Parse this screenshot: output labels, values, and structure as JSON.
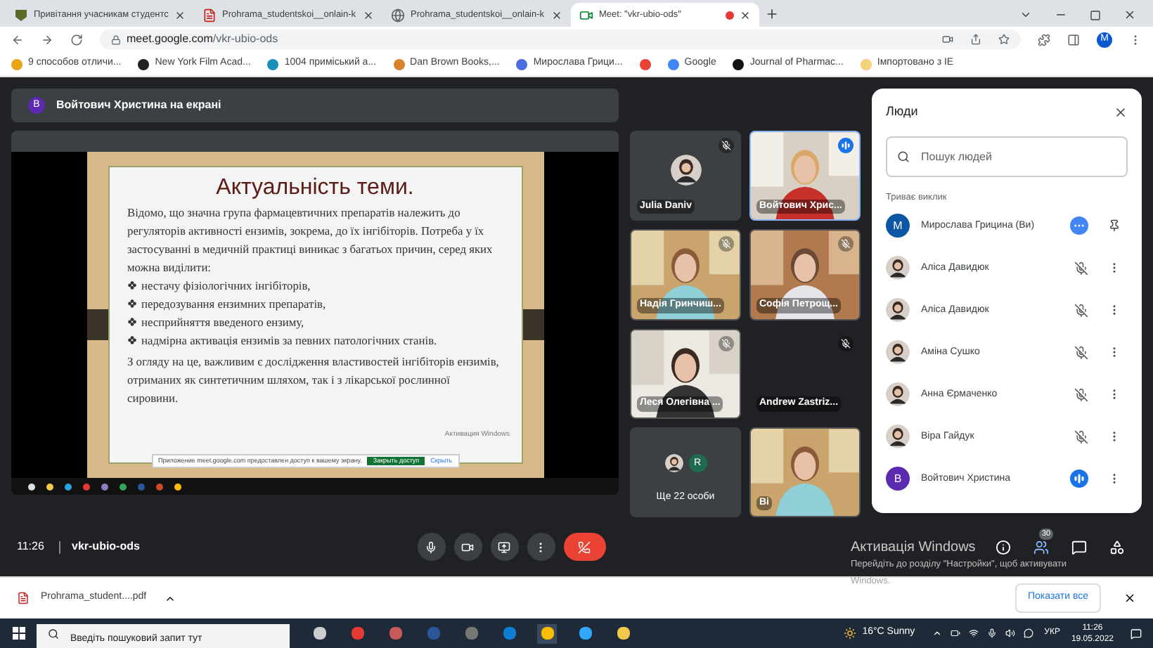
{
  "browser": {
    "tabs": [
      {
        "title": "Привітання учасникам студентс",
        "kind": "crest",
        "selected": false,
        "recording": false
      },
      {
        "title": "Prohrama_studentskoi__onlain-k",
        "kind": "pdf",
        "selected": false,
        "recording": false
      },
      {
        "title": "Prohrama_studentskoi__onlain-k",
        "kind": "globe",
        "selected": false,
        "recording": false
      },
      {
        "title": "Meet: \"vkr-ubio-ods\"",
        "kind": "meet",
        "selected": true,
        "recording": true
      }
    ],
    "url_host": "meet.google.com",
    "url_path": "/vkr-ubio-ods",
    "profile": "M",
    "bookmarks": [
      {
        "title": "9 способов отличи...",
        "color": "#e8a317"
      },
      {
        "title": "New York Film Acad...",
        "color": "#222222"
      },
      {
        "title": "1004 приміський а...",
        "color": "#1a8fb8"
      },
      {
        "title": "Dan Brown Books,...",
        "color": "#d9822b"
      },
      {
        "title": "Мирослава Грици...",
        "color": "#4a6ee0"
      },
      {
        "color": "#ea4335"
      },
      {
        "title": "Google",
        "color": "#4285f4"
      },
      {
        "title": "Journal of Pharmac...",
        "color": "#111111"
      },
      {
        "title": "Імпортовано з IE",
        "color": "#f4d27a"
      }
    ]
  },
  "meeting": {
    "presenter": {
      "avatar": "В",
      "text": "Войтович Христина на екрані"
    },
    "slide": {
      "title": "Актуальність теми.",
      "intro": "Відомо, що значна група фармацевтичних препаратів належить до регуляторів активності ензимів, зокрема, до їх інгібіторів. Потреба у їх застосуванні в медичній практиці виникає з багатьох причин, серед яких можна виділити:",
      "bullets": [
        "нестачу фізіологічних інгібіторів,",
        "передозування ензимних препаратів,",
        "несприйняття введеного ензиму,",
        "надмірна активація ензимів за певних патологічних станів."
      ],
      "conclusion": "З огляду на це, важливим є дослідження властивостей інгібіторів ензимів, отриманих як синтетичним шляхом, так і з лікарської рослинної сировини.",
      "watermark": "Активация Windows",
      "notice": "Приложение meet.google.com предоставлен доступ к вашему экрану.",
      "notice_button": "Закрыть доступ",
      "notice_link": "Скрыть"
    },
    "tiles": [
      {
        "kind": "avatar",
        "name": "Julia Daniv",
        "muted": true,
        "speaking": false
      },
      {
        "kind": "video",
        "name": "Войтович Хрис...",
        "muted": false,
        "speaking": true
      },
      {
        "kind": "video",
        "name": "Надія Гринчиш...",
        "muted": true,
        "speaking": false
      },
      {
        "kind": "video",
        "name": "Софія Петрощ...",
        "muted": true,
        "speaking": false
      },
      {
        "kind": "video",
        "name": "Леся Олегівна ...",
        "muted": true,
        "speaking": false
      },
      {
        "kind": "blank",
        "name": "Andrew Zastriz...",
        "muted": true,
        "speaking": false
      },
      {
        "kind": "more",
        "name": "Ще 22 особи",
        "letter": "R",
        "muted": false,
        "speaking": false
      },
      {
        "kind": "video",
        "name": "Ві",
        "muted": false,
        "speaking": false
      }
    ],
    "people": {
      "title": "Люди",
      "search_placeholder": "Пошук людей",
      "section": "Триває виклик",
      "list": [
        {
          "kind": "self",
          "name": "Мирослава Грицина (Ви)",
          "letter": "M",
          "color": "#0b57a4",
          "muted": false,
          "speaking": false
        },
        {
          "kind": "other",
          "name": "Аліса Давидюк",
          "muted": true,
          "speaking": false
        },
        {
          "kind": "other",
          "name": "Аліса Давидюк",
          "muted": true,
          "speaking": false
        },
        {
          "kind": "other",
          "name": "Аміна Сушко",
          "muted": true,
          "speaking": false
        },
        {
          "kind": "other",
          "name": "Анна Єрмаченко",
          "muted": true,
          "speaking": false
        },
        {
          "kind": "other",
          "name": "Віра Гайдук",
          "muted": true,
          "speaking": false
        },
        {
          "kind": "other",
          "name": "Войтович Христина",
          "letter": "В",
          "color": "#5b2ab0",
          "muted": false,
          "speaking": true
        }
      ]
    },
    "time": "11:26",
    "code": "vkr-ubio-ods",
    "people_count": "30",
    "activation": {
      "title": "Активація Windows",
      "text": "Перейдіть до розділу \"Настройки\", щоб активувати",
      "text2": "Windows."
    }
  },
  "download": {
    "file": "Prohrama_student....pdf",
    "show_all": "Показати все"
  },
  "taskbar": {
    "search_placeholder": "Введіть пошуковий запит тут",
    "weather": "16°C Sunny",
    "lang": "УКР",
    "time": "11:26",
    "date": "19.05.2022"
  }
}
